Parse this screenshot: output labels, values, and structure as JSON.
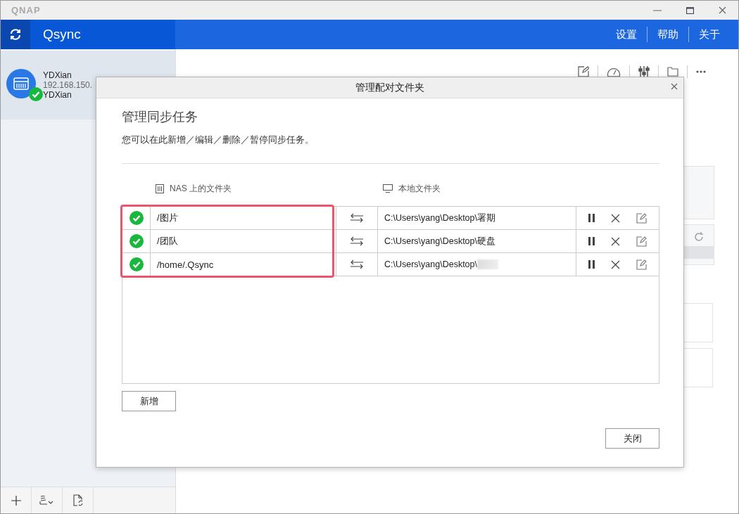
{
  "window": {
    "brand": "QNAP"
  },
  "header": {
    "title": "Qsync",
    "menu": [
      "设置",
      "帮助",
      "关于"
    ]
  },
  "sidebar": {
    "devices": [
      {
        "name": "YDXian",
        "address": "192.168.150.",
        "user": "YDXian",
        "selected": true,
        "connected": true
      }
    ]
  },
  "dialog": {
    "title": "管理配对文件夹",
    "heading": "管理同步任务",
    "description": "您可以在此新增／编辑／删除／暂停同步任务。",
    "columns": [
      "NAS 上的文件夹",
      "本地文件夹"
    ],
    "rows": [
      {
        "synced": true,
        "nas": "/图片",
        "local": "C:\\Users\\yang\\Desktop\\署期",
        "redacted": false
      },
      {
        "synced": true,
        "nas": "/团队",
        "local": "C:\\Users\\yang\\Desktop\\硬盘",
        "redacted": false
      },
      {
        "synced": true,
        "nas": "/home/.Qsync",
        "local": "C:\\Users\\yang\\Desktop\\",
        "redacted": true
      }
    ],
    "highlight": true,
    "add_button": "新增",
    "close_button": "关闭"
  }
}
